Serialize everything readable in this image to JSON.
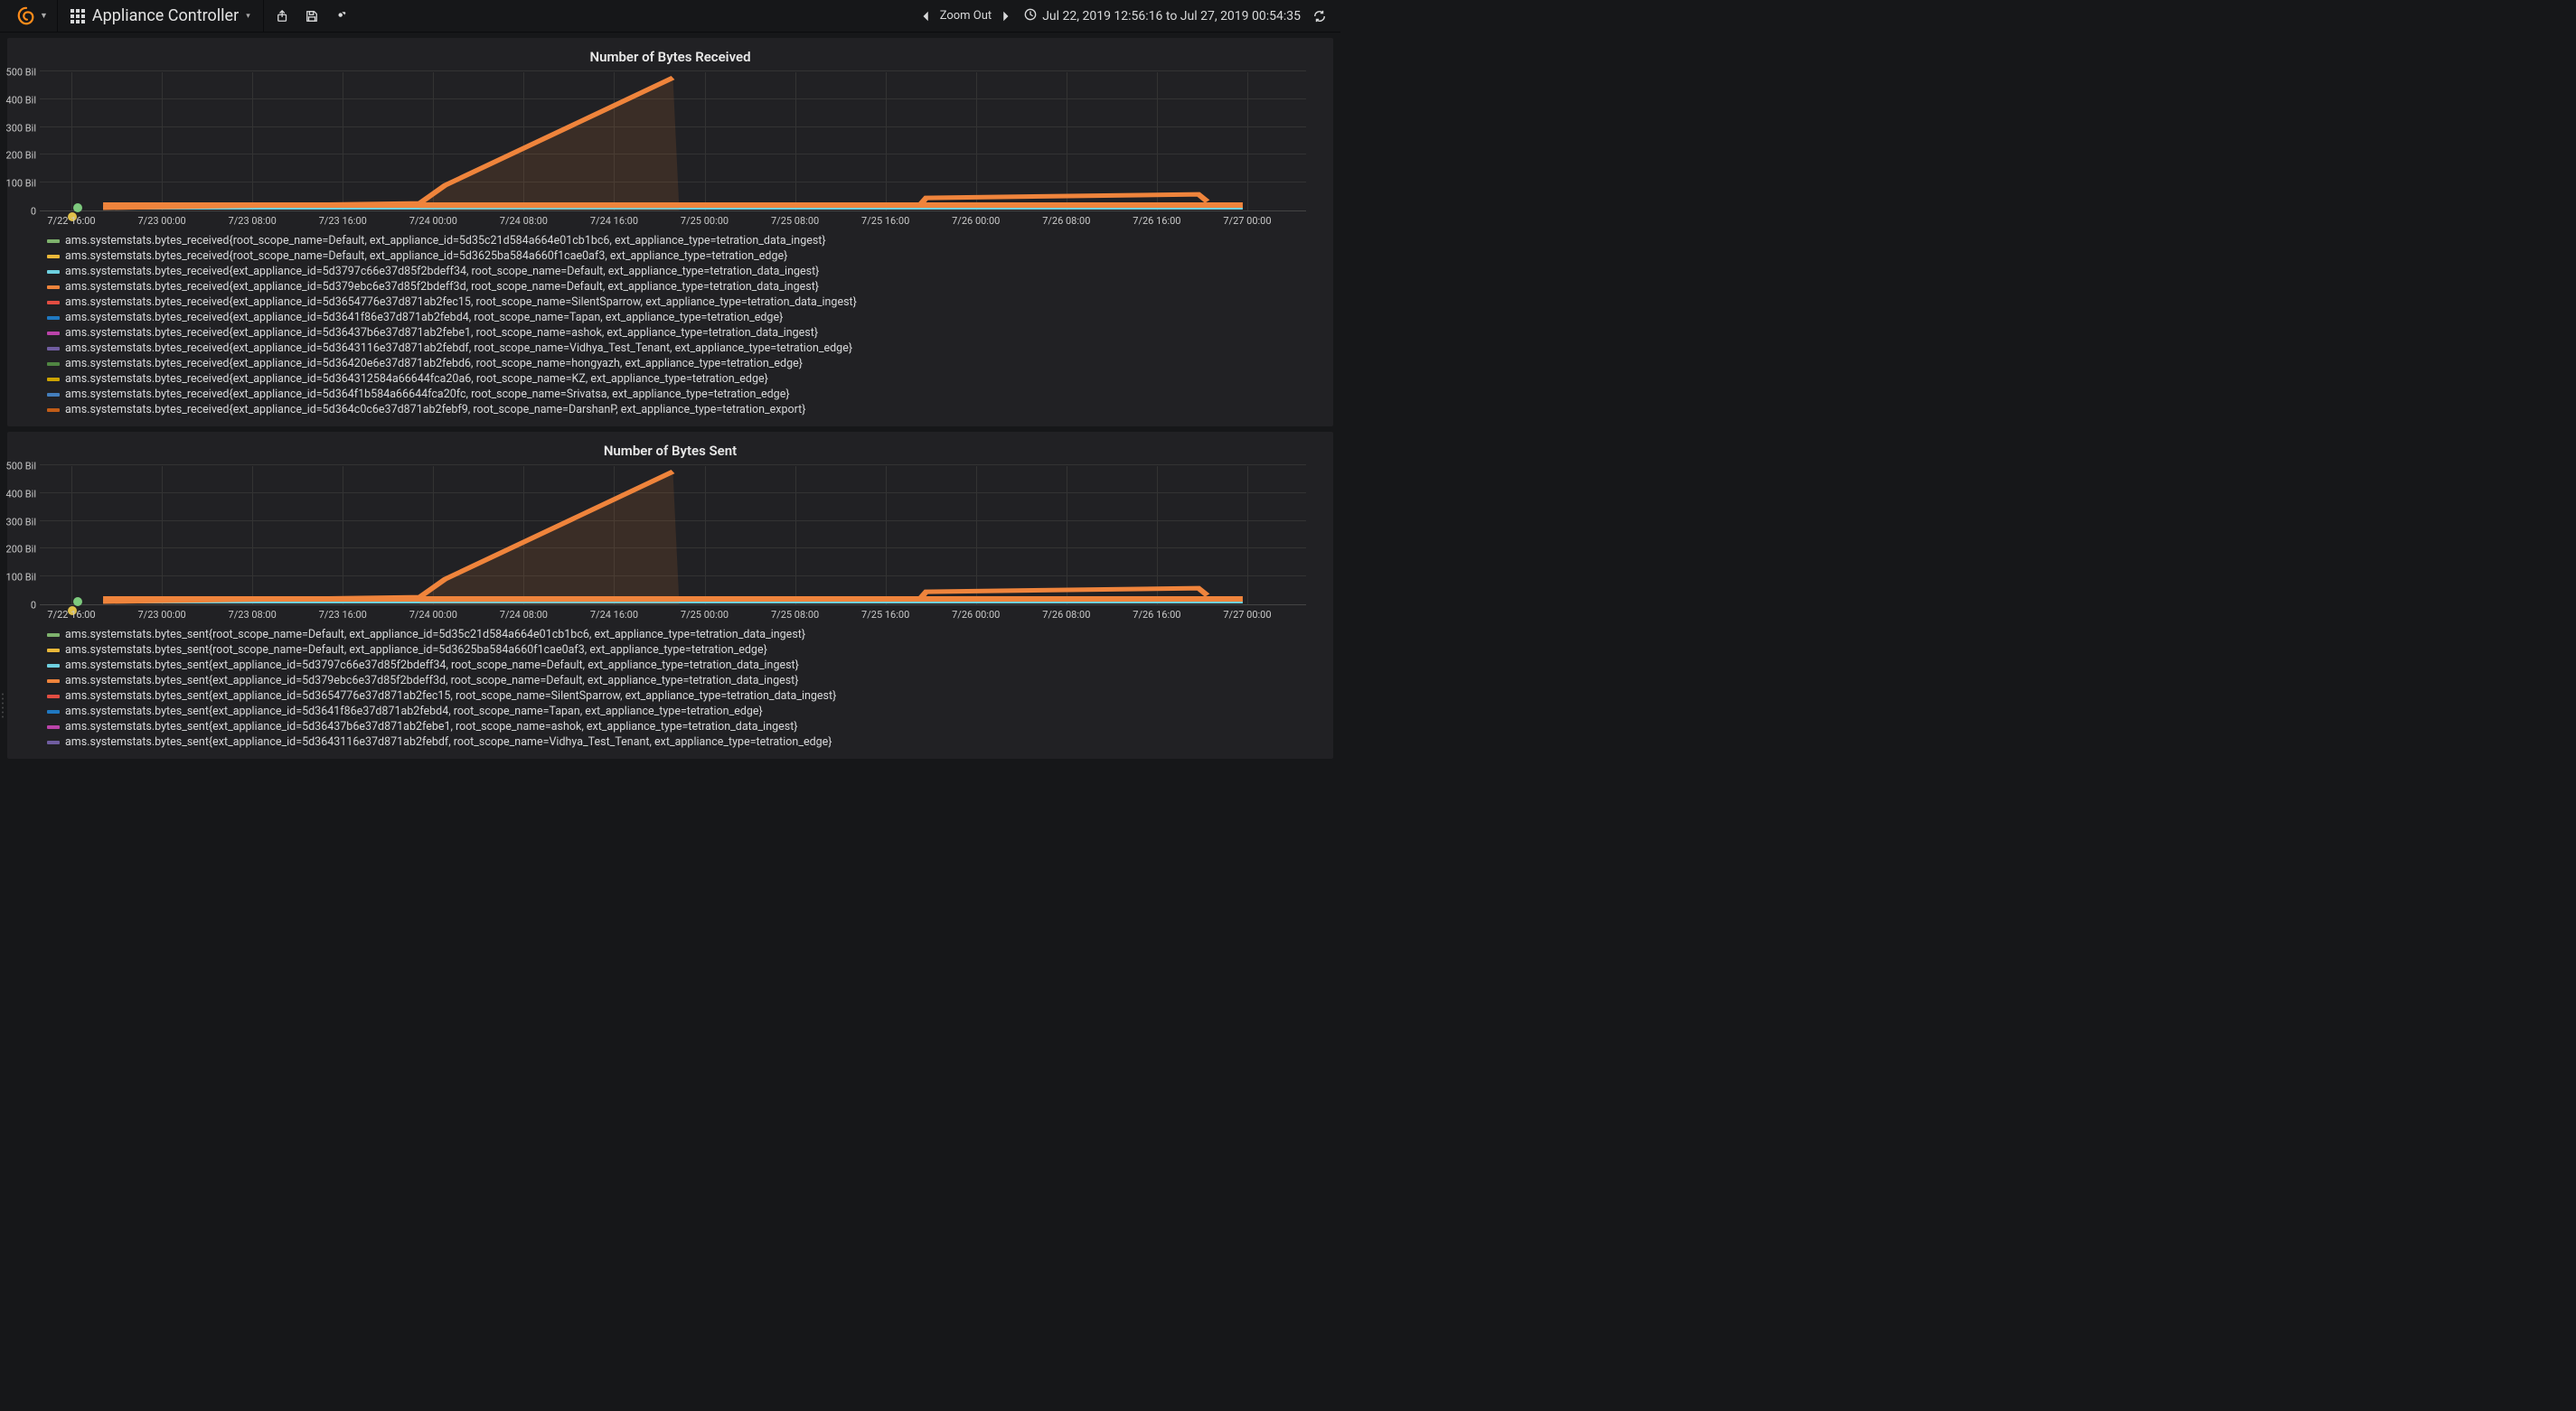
{
  "header": {
    "dashboard_title": "Appliance Controller",
    "zoom_out": "Zoom Out",
    "time_range": "Jul 22, 2019 12:56:16 to Jul 27, 2019 00:54:35"
  },
  "chart_data": [
    {
      "type": "line",
      "title": "Number of Bytes Received",
      "ylabel": "",
      "ylim": [
        0,
        500000000000
      ],
      "y_ticks": [
        "0",
        "100 Bil",
        "200 Bil",
        "300 Bil",
        "400 Bil",
        "500 Bil"
      ],
      "x_ticks": [
        "7/22 16:00",
        "7/23 00:00",
        "7/23 08:00",
        "7/23 16:00",
        "7/24 00:00",
        "7/24 08:00",
        "7/24 16:00",
        "7/25 00:00",
        "7/25 08:00",
        "7/25 16:00",
        "7/26 00:00",
        "7/26 08:00",
        "7/26 16:00",
        "7/27 00:00"
      ],
      "x_range": [
        "2019-07-22T12:56:16",
        "2019-07-27T00:54:35"
      ],
      "series": [
        {
          "name": "ams.systemstats.bytes_received{root_scope_name=Default, ext_appliance_id=5d35c21d584a664e01cb1bc6, ext_appliance_type=tetration_data_ingest}",
          "color": "#7EB26D",
          "sample": [
            [
              0.02,
              0.1
            ],
            [
              0.03,
              0.12
            ]
          ]
        },
        {
          "name": "ams.systemstats.bytes_received{root_scope_name=Default, ext_appliance_id=5d3625ba584a660f1cae0af3, ext_appliance_type=tetration_edge}",
          "color": "#EAB839",
          "sample": [
            [
              0.02,
              0.02
            ],
            [
              0.03,
              0.05
            ]
          ]
        },
        {
          "name": "ams.systemstats.bytes_received{ext_appliance_id=5d3797c66e37d85f2bdeff34, root_scope_name=Default, ext_appliance_type=tetration_data_ingest}",
          "color": "#6ED0E0",
          "sample": [
            [
              0.05,
              0.01
            ],
            [
              0.95,
              0.02
            ]
          ]
        },
        {
          "name": "ams.systemstats.bytes_received{ext_appliance_id=5d379ebc6e37d85f2bdeff3d, root_scope_name=Default, ext_appliance_type=tetration_data_ingest}",
          "color": "#EF843C",
          "sample": [
            [
              0.05,
              0.02
            ],
            [
              0.3,
              0.06
            ],
            [
              0.32,
              0.16
            ],
            [
              0.5,
              0.94
            ],
            [
              0.51,
              null
            ],
            [
              0.7,
              0.04
            ],
            [
              0.71,
              0.06
            ],
            [
              0.92,
              0.08
            ],
            [
              0.93,
              0.06
            ]
          ]
        },
        {
          "name": "ams.systemstats.bytes_received{ext_appliance_id=5d3654776e37d871ab2fec15, root_scope_name=SilentSparrow, ext_appliance_type=tetration_data_ingest}",
          "color": "#E24D42",
          "sample": [
            [
              0.05,
              0.01
            ],
            [
              0.95,
              0.01
            ]
          ]
        },
        {
          "name": "ams.systemstats.bytes_received{ext_appliance_id=5d3641f86e37d871ab2febd4, root_scope_name=Tapan, ext_appliance_type=tetration_edge}",
          "color": "#1F78C1",
          "sample": [
            [
              0.05,
              0.01
            ],
            [
              0.95,
              0.01
            ]
          ]
        },
        {
          "name": "ams.systemstats.bytes_received{ext_appliance_id=5d36437b6e37d871ab2febe1, root_scope_name=ashok, ext_appliance_type=tetration_data_ingest}",
          "color": "#BA43A9",
          "sample": [
            [
              0.05,
              0.01
            ],
            [
              0.95,
              0.01
            ]
          ]
        },
        {
          "name": "ams.systemstats.bytes_received{ext_appliance_id=5d3643116e37d871ab2febdf, root_scope_name=Vidhya_Test_Tenant, ext_appliance_type=tetration_edge}",
          "color": "#705DA0",
          "sample": [
            [
              0.05,
              0.01
            ],
            [
              0.95,
              0.01
            ]
          ]
        },
        {
          "name": "ams.systemstats.bytes_received{ext_appliance_id=5d36420e6e37d871ab2febd6, root_scope_name=hongyazh, ext_appliance_type=tetration_edge}",
          "color": "#508642",
          "sample": [
            [
              0.05,
              0.01
            ],
            [
              0.95,
              0.01
            ]
          ]
        },
        {
          "name": "ams.systemstats.bytes_received{ext_appliance_id=5d364312584a66644fca20a6, root_scope_name=KZ, ext_appliance_type=tetration_edge}",
          "color": "#CCA300",
          "sample": [
            [
              0.05,
              0.01
            ],
            [
              0.95,
              0.01
            ]
          ]
        },
        {
          "name": "ams.systemstats.bytes_received{ext_appliance_id=5d364f1b584a66644fca20fc, root_scope_name=Srivatsa, ext_appliance_type=tetration_edge}",
          "color": "#447EBC",
          "sample": [
            [
              0.05,
              0.01
            ],
            [
              0.95,
              0.01
            ]
          ]
        },
        {
          "name": "ams.systemstats.bytes_received{ext_appliance_id=5d364c0c6e37d871ab2febf9, root_scope_name=DarshanP, ext_appliance_type=tetration_export}",
          "color": "#C15C17",
          "sample": [
            [
              0.05,
              0.01
            ],
            [
              0.95,
              0.01
            ]
          ]
        }
      ]
    },
    {
      "type": "line",
      "title": "Number of Bytes Sent",
      "ylabel": "",
      "ylim": [
        0,
        500000000000
      ],
      "y_ticks": [
        "0",
        "100 Bil",
        "200 Bil",
        "300 Bil",
        "400 Bil",
        "500 Bil"
      ],
      "x_ticks": [
        "7/22 16:00",
        "7/23 00:00",
        "7/23 08:00",
        "7/23 16:00",
        "7/24 00:00",
        "7/24 08:00",
        "7/24 16:00",
        "7/25 00:00",
        "7/25 08:00",
        "7/25 16:00",
        "7/26 00:00",
        "7/26 08:00",
        "7/26 16:00",
        "7/27 00:00"
      ],
      "x_range": [
        "2019-07-22T12:56:16",
        "2019-07-27T00:54:35"
      ],
      "series": [
        {
          "name": "ams.systemstats.bytes_sent{root_scope_name=Default, ext_appliance_id=5d35c21d584a664e01cb1bc6, ext_appliance_type=tetration_data_ingest}",
          "color": "#7EB26D",
          "sample": [
            [
              0.02,
              0.1
            ],
            [
              0.03,
              0.12
            ]
          ]
        },
        {
          "name": "ams.systemstats.bytes_sent{root_scope_name=Default, ext_appliance_id=5d3625ba584a660f1cae0af3, ext_appliance_type=tetration_edge}",
          "color": "#EAB839",
          "sample": [
            [
              0.02,
              0.02
            ],
            [
              0.03,
              0.05
            ]
          ]
        },
        {
          "name": "ams.systemstats.bytes_sent{ext_appliance_id=5d3797c66e37d85f2bdeff34, root_scope_name=Default, ext_appliance_type=tetration_data_ingest}",
          "color": "#6ED0E0",
          "sample": [
            [
              0.05,
              0.01
            ],
            [
              0.95,
              0.02
            ]
          ]
        },
        {
          "name": "ams.systemstats.bytes_sent{ext_appliance_id=5d379ebc6e37d85f2bdeff3d, root_scope_name=Default, ext_appliance_type=tetration_data_ingest}",
          "color": "#EF843C",
          "sample": [
            [
              0.05,
              0.02
            ],
            [
              0.3,
              0.06
            ],
            [
              0.32,
              0.18
            ],
            [
              0.5,
              0.98
            ],
            [
              0.51,
              null
            ],
            [
              0.7,
              0.04
            ],
            [
              0.71,
              0.06
            ],
            [
              0.92,
              0.08
            ],
            [
              0.93,
              0.06
            ]
          ]
        },
        {
          "name": "ams.systemstats.bytes_sent{ext_appliance_id=5d3654776e37d871ab2fec15, root_scope_name=SilentSparrow, ext_appliance_type=tetration_data_ingest}",
          "color": "#E24D42",
          "sample": [
            [
              0.05,
              0.01
            ],
            [
              0.95,
              0.01
            ]
          ]
        },
        {
          "name": "ams.systemstats.bytes_sent{ext_appliance_id=5d3641f86e37d871ab2febd4, root_scope_name=Tapan, ext_appliance_type=tetration_edge}",
          "color": "#1F78C1",
          "sample": [
            [
              0.05,
              0.01
            ],
            [
              0.95,
              0.01
            ]
          ]
        },
        {
          "name": "ams.systemstats.bytes_sent{ext_appliance_id=5d36437b6e37d871ab2febe1, root_scope_name=ashok, ext_appliance_type=tetration_data_ingest}",
          "color": "#BA43A9",
          "sample": [
            [
              0.05,
              0.01
            ],
            [
              0.95,
              0.01
            ]
          ]
        },
        {
          "name": "ams.systemstats.bytes_sent{ext_appliance_id=5d3643116e37d871ab2febdf, root_scope_name=Vidhya_Test_Tenant, ext_appliance_type=tetration_edge}",
          "color": "#705DA0",
          "sample": [
            [
              0.05,
              0.01
            ],
            [
              0.95,
              0.01
            ]
          ]
        }
      ]
    }
  ]
}
